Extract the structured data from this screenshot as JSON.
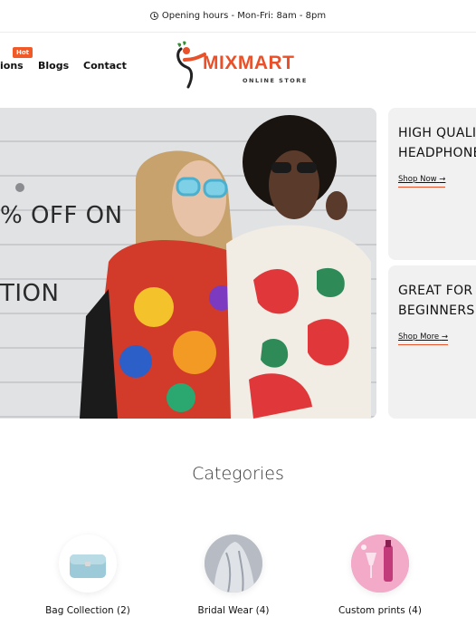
{
  "topbar": {
    "text": "Opening hours - Mon-Fri: 8am - 8pm",
    "icon": "clock-icon"
  },
  "nav": {
    "items": [
      {
        "label": "ions"
      },
      {
        "label": "Blogs"
      },
      {
        "label": "Contact"
      }
    ],
    "hot_badge": "Hot"
  },
  "logo": {
    "brand": "MIXMART",
    "tagline": "ONLINE STORE",
    "accent": "#e8512a"
  },
  "hero": {
    "line1": "% OFF ON",
    "line2": "TION"
  },
  "side_cards": [
    {
      "title_line1": "HIGH QUALIT",
      "title_line2": "HEADPHONE",
      "cta": "Shop Now"
    },
    {
      "title_line1": "GREAT FOR",
      "title_line2": "BEGINNERS",
      "cta": "Shop More"
    }
  ],
  "categories": {
    "heading": "Categories",
    "items": [
      {
        "label": "Bag Collection (2)"
      },
      {
        "label": "Bridal Wear (4)"
      },
      {
        "label": "Custom prints (4)"
      }
    ]
  },
  "colors": {
    "accent": "#f05a28",
    "card_bg": "#f1f1f1"
  }
}
